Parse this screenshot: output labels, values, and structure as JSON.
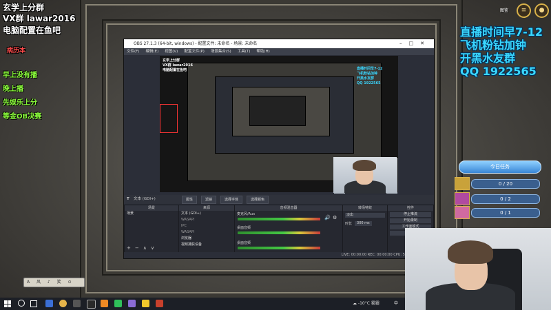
{
  "overlay_left": {
    "line1": "玄学上分群",
    "line2": "VX群 lawar2016",
    "line3": "电脑配置在鱼吧",
    "red_label": "病历本",
    "green_lines": [
      "早上没有播",
      "晚上播",
      "先娱乐上分",
      "等金OB决赛"
    ]
  },
  "overlay_right": {
    "line1": "直播时间早7-12",
    "line2": "飞机粉钻加钟",
    "line3": "开黑水友群",
    "line4": "QQ 1922565"
  },
  "game_ui": {
    "top_label": "图鉴",
    "quest_button": "今日任务",
    "quests": [
      {
        "progress": "0 / 20",
        "color": "#c9a23a"
      },
      {
        "progress": "0 / 2",
        "color": "#b04aa0"
      },
      {
        "progress": "0 / 1",
        "color": "#d06aa0"
      }
    ]
  },
  "obs": {
    "title": "OBS 27.1.3 (64-bit, windows) - 配置文件: 未命名 - 场景: 未命名",
    "menu": [
      "文件(F)",
      "编辑(E)",
      "视图(V)",
      "配置文件(P)",
      "场景集合(S)",
      "工具(T)",
      "帮助(H)"
    ],
    "toolbar_source": "文本 (GDI+)",
    "toolbar_buttons": [
      "属性",
      "滤镜",
      "选择字体",
      "选择颜色"
    ],
    "panels": {
      "scenes": "场景",
      "sources": "来源",
      "mixer": "音频混音器",
      "transitions": "转场特效",
      "controls": "控件"
    },
    "scenes_list": [
      "场景"
    ],
    "sources_list": [
      "文本 (GDI+)",
      "WASAPI",
      "IPC",
      "WASAPI",
      "浏览器",
      "视频捕获设备"
    ],
    "mixer_tracks": [
      "麦克风/Aux",
      "桌面音频",
      "桌面音频"
    ],
    "transition_value": "淡出",
    "duration_label": "时长",
    "duration_value": "300 ms",
    "controls_list": [
      "停止推流",
      "开始录制",
      "工作室模式",
      "退出"
    ],
    "status_text": "LIVE: 00:00:00   REC: 00:00:00   CPU: 5.7%, 60.00 fps"
  },
  "taskbar": {
    "weather": "-10°C 雾霾",
    "ime": "中"
  },
  "mini_toolbar": "A 风 ♪ 笑 ⊙ ⊙ ⊙"
}
